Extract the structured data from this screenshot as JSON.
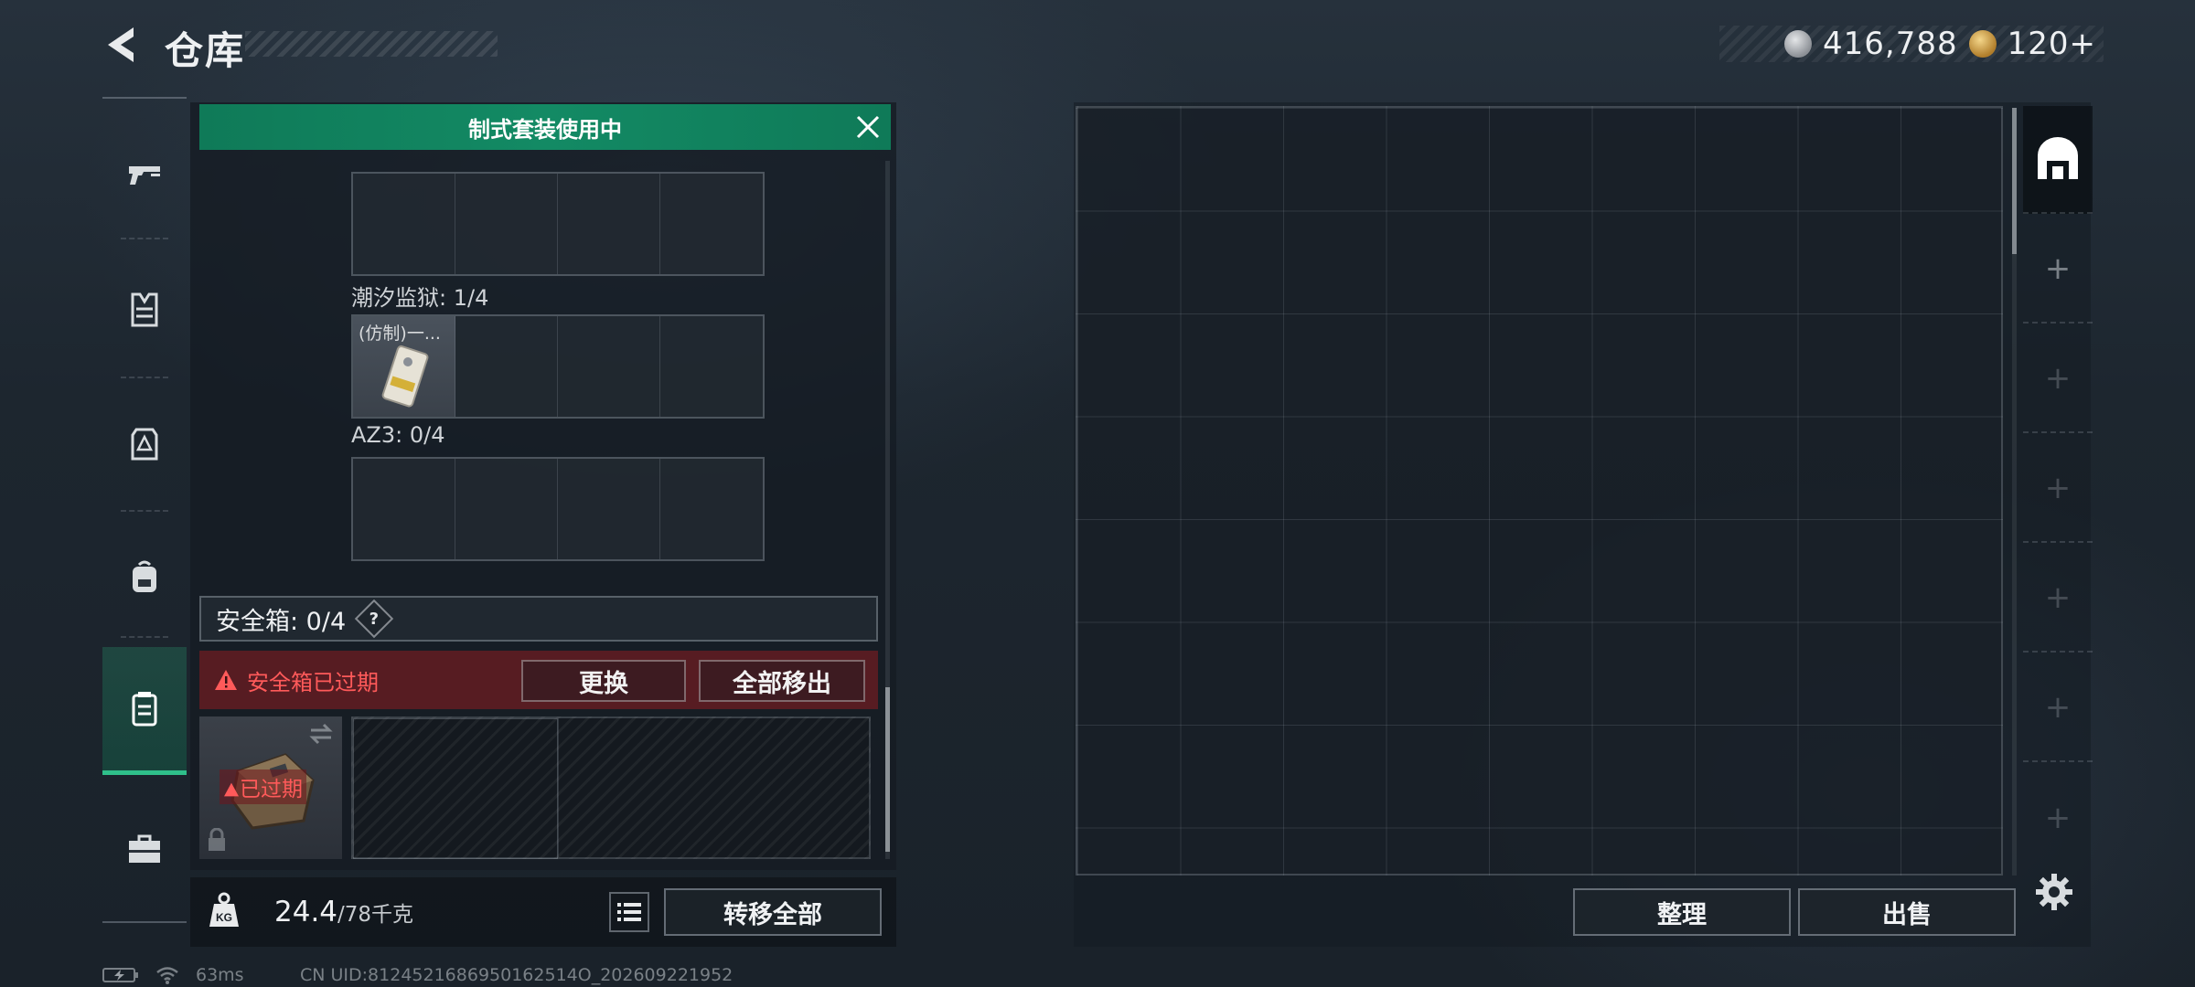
{
  "header": {
    "title": "仓库",
    "currency_silver": "416,788",
    "currency_gold": "120+"
  },
  "nav": {
    "items": [
      "pistol-icon",
      "vest-icon",
      "armor-icon",
      "backpack-icon",
      "container-icon",
      "toolbox-icon"
    ],
    "active_index": 4
  },
  "banner": {
    "text": "制式套装使用中"
  },
  "groups": [
    {
      "label": "潮汐监狱: 1/4",
      "item_label": "(仿制)一..."
    },
    {
      "label": "AZ3: 0/4"
    }
  ],
  "safebox": {
    "label": "安全箱: 0/4",
    "help": "?",
    "expired_text": "安全箱已过期",
    "replace_label": "更换",
    "move_all_label": "全部移出",
    "case_status": "已过期"
  },
  "bottom": {
    "weight_current": "24.4",
    "weight_max": "/78千克",
    "transfer_all_label": "转移全部"
  },
  "stash": {
    "sort_label": "整理",
    "sell_label": "出售"
  },
  "status": {
    "ping": "63ms",
    "uid": "CN UID:8124521686950162514O_202609221952"
  },
  "colors": {
    "accent_green": "#138a64",
    "warning_red": "#ff5a5a"
  }
}
